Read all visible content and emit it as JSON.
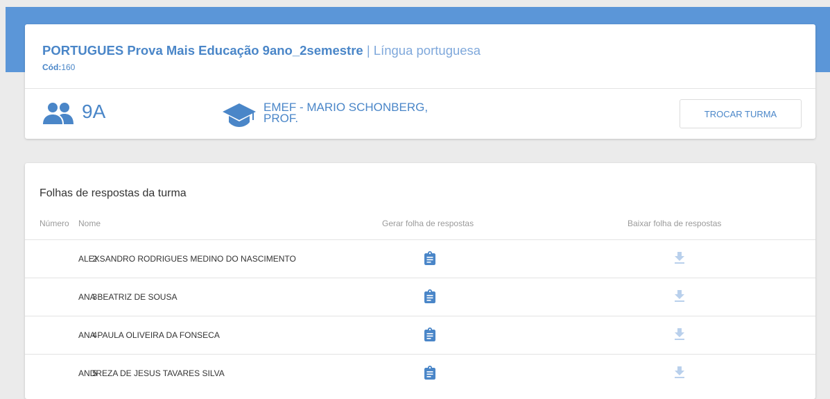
{
  "header": {
    "title": "PORTUGUES Prova Mais Educação 9ano_2semestre",
    "separator": " | ",
    "subject": "Língua portuguesa",
    "code_label": "Cód:",
    "code_value": "160"
  },
  "class_info": {
    "class_name": "9A",
    "school_name": "EMEF - MARIO SCHONBERG, PROF.",
    "change_button": "TROCAR TURMA",
    "class_icon": "group-icon",
    "school_icon": "graduation-cap-icon"
  },
  "answer_sheets": {
    "title": "Folhas de respostas da turma",
    "columns": {
      "number": "Número",
      "name": "Nome",
      "generate": "Gerar folha de respostas",
      "download": "Baixar folha de respostas"
    },
    "rows": [
      {
        "number": "2",
        "name": "ALEXSANDRO RODRIGUES MEDINO DO NASCIMENTO"
      },
      {
        "number": "3",
        "name": "ANA BEATRIZ DE SOUSA"
      },
      {
        "number": "4",
        "name": "ANA PAULA OLIVEIRA DA FONSECA"
      },
      {
        "number": "5",
        "name": "ANDREZA DE JESUS TAVARES SILVA"
      }
    ],
    "generate_icon": "clipboard-icon",
    "download_icon": "download-icon"
  },
  "colors": {
    "accent": "#4a86c8",
    "header_band": "#5b96d8",
    "download_disabled": "#b9d0ec"
  }
}
